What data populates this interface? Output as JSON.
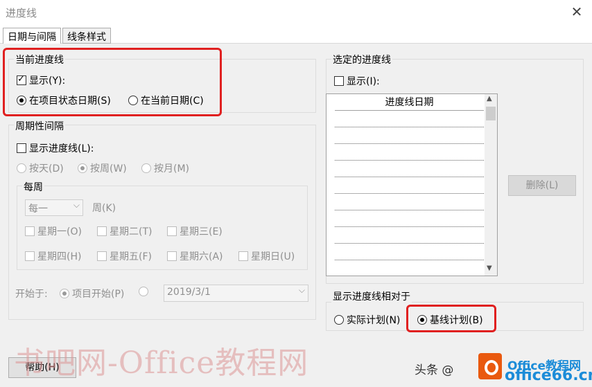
{
  "window": {
    "title": "进度线",
    "close_glyph": "✕"
  },
  "tabs": [
    {
      "label": "日期与间隔",
      "active": true
    },
    {
      "label": "线条样式",
      "active": false
    }
  ],
  "current_progress": {
    "title": "当前进度线",
    "show_label": "显示(Y):",
    "show_checked": true,
    "radio_status_date": "在项目状态日期(S)",
    "radio_current_date": "在当前日期(C)",
    "selected": "status_date"
  },
  "periodic": {
    "title": "周期性间隔",
    "show_label": "显示进度线(L):",
    "show_checked": false,
    "radio_daily": "按天(D)",
    "radio_weekly": "按周(W)",
    "radio_monthly": "按月(M)",
    "selected": "weekly",
    "weekly": {
      "title": "每周",
      "combo_value": "每一",
      "combo_suffix": "周(K)",
      "days": [
        "星期一(O)",
        "星期二(T)",
        "星期三(E)",
        "星期四(H)",
        "星期五(F)",
        "星期六(A)",
        "星期日(U)"
      ]
    },
    "start_label": "开始于:",
    "start_project": "项目开始(P)",
    "start_date": "2019/3/1"
  },
  "selected_progress": {
    "title": "选定的进度线",
    "show_label": "显示(I):",
    "show_checked": false,
    "column_header": "进度线日期",
    "delete_button": "删除(L)"
  },
  "relative_to": {
    "title": "显示进度线相对于",
    "radio_actual": "实际计划(N)",
    "radio_baseline": "基线计划(B)",
    "selected": "baseline"
  },
  "footer": {
    "help_button": "帮助(H)",
    "watermark": "书吧网-Office教程网",
    "credit": "头条 @",
    "brand_top": "Office教程网",
    "brand_bottom": "office66.cn"
  },
  "colors": {
    "highlight": "#e02020",
    "brand": "#1c8cd8",
    "logo": "#e9590f"
  }
}
